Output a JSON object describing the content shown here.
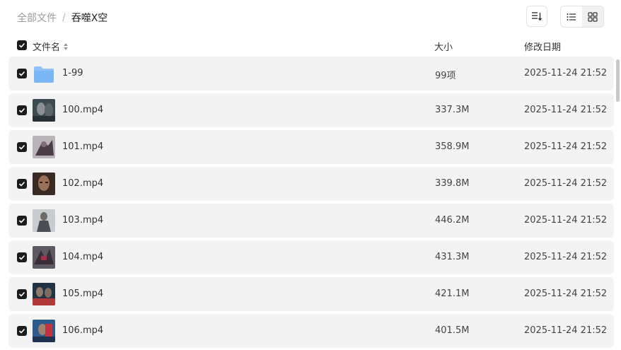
{
  "breadcrumb": {
    "root": "全部文件",
    "separator": "/",
    "current": "吞噬X空"
  },
  "table_header": {
    "checked": true,
    "name": "文件名",
    "size": "大小",
    "date": "修改日期"
  },
  "items": [
    {
      "name": "1-99",
      "type": "folder",
      "size": "99项",
      "date": "2025-11-24 21:52",
      "checked": true,
      "thumb": "folder-icon"
    },
    {
      "name": "100.mp4",
      "type": "video",
      "size": "337.3M",
      "date": "2025-11-24 21:52",
      "checked": true,
      "thumb": "video-thumbnail"
    },
    {
      "name": "101.mp4",
      "type": "video",
      "size": "358.9M",
      "date": "2025-11-24 21:52",
      "checked": true,
      "thumb": "video-thumbnail"
    },
    {
      "name": "102.mp4",
      "type": "video",
      "size": "339.8M",
      "date": "2025-11-24 21:52",
      "checked": true,
      "thumb": "video-thumbnail"
    },
    {
      "name": "103.mp4",
      "type": "video",
      "size": "446.2M",
      "date": "2025-11-24 21:52",
      "checked": true,
      "thumb": "video-thumbnail"
    },
    {
      "name": "104.mp4",
      "type": "video",
      "size": "431.3M",
      "date": "2025-11-24 21:52",
      "checked": true,
      "thumb": "video-thumbnail"
    },
    {
      "name": "105.mp4",
      "type": "video",
      "size": "421.1M",
      "date": "2025-11-24 21:52",
      "checked": true,
      "thumb": "video-thumbnail"
    },
    {
      "name": "106.mp4",
      "type": "video",
      "size": "401.5M",
      "date": "2025-11-24 21:52",
      "checked": true,
      "thumb": "video-thumbnail"
    }
  ],
  "colors": {
    "row_bg": "#f3f3f3",
    "checkbox": "#1b1b1b",
    "folder": "#7bb7f5"
  }
}
